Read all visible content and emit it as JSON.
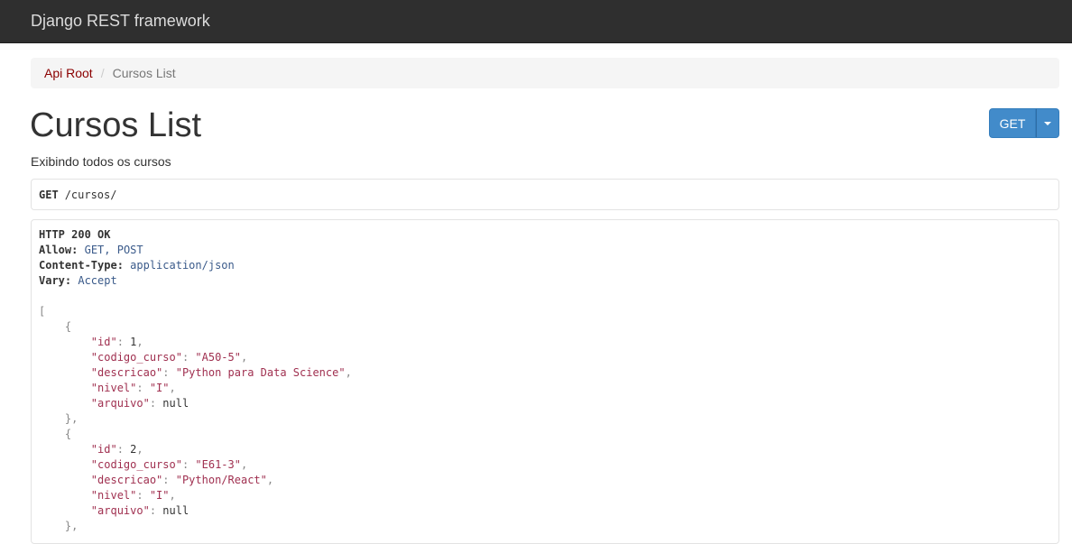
{
  "navbar": {
    "brand": "Django REST framework"
  },
  "breadcrumb": {
    "root": "Api Root",
    "separator": "/",
    "current": "Cursos List"
  },
  "page": {
    "title": "Cursos List",
    "description": "Exibindo todos os cursos"
  },
  "get_button": {
    "label": "GET"
  },
  "request": {
    "method": "GET",
    "path": "/cursos/"
  },
  "response": {
    "status": "HTTP 200 OK",
    "headers": {
      "allow_key": "Allow:",
      "allow_val": "GET, POST",
      "content_type_key": "Content-Type:",
      "content_type_val": "application/json",
      "vary_key": "Vary:",
      "vary_val": "Accept"
    },
    "items": [
      {
        "id": "1",
        "codigo_curso": "\"A50-5\"",
        "descricao": "\"Python para Data Science\"",
        "nivel": "\"I\"",
        "arquivo": "null"
      },
      {
        "id": "2",
        "codigo_curso": "\"E61-3\"",
        "descricao": "\"Python/React\"",
        "nivel": "\"I\"",
        "arquivo": "null"
      }
    ],
    "keys": {
      "id": "\"id\"",
      "codigo_curso": "\"codigo_curso\"",
      "descricao": "\"descricao\"",
      "nivel": "\"nivel\"",
      "arquivo": "\"arquivo\""
    }
  },
  "colors": {
    "navbar": "#2f2f2f",
    "link": "#8b0000",
    "button": "#428bca",
    "json_string": "#a03050"
  }
}
